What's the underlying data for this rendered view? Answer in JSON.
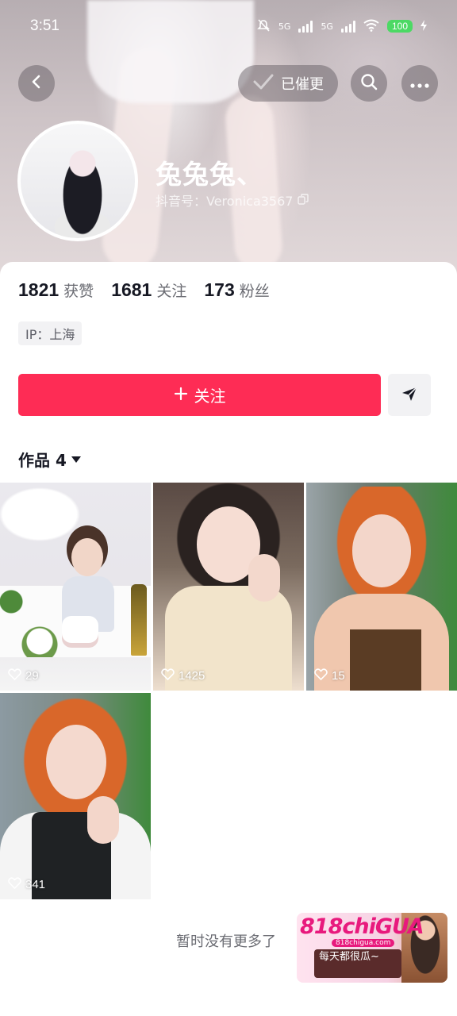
{
  "status_bar": {
    "time": "3:51",
    "network_1": "5G",
    "network_2": "5G",
    "battery": "100"
  },
  "top_bar": {
    "urge_label": "已催更"
  },
  "profile": {
    "name": "兔兔兔、",
    "uid_label": "抖音号：Veronica3567",
    "stats": [
      {
        "num": "1821",
        "label": "获赞"
      },
      {
        "num": "1681",
        "label": "关注"
      },
      {
        "num": "173",
        "label": "粉丝"
      }
    ],
    "ip": "IP：上海"
  },
  "actions": {
    "follow_label": "关注"
  },
  "works": {
    "tab_label": "作品 4",
    "items": [
      {
        "likes": "29"
      },
      {
        "likes": "1425"
      },
      {
        "likes": "15"
      },
      {
        "likes": "341"
      }
    ],
    "end_text": "暂时没有更多了"
  },
  "ad": {
    "brand": "818chiGUA",
    "url": "818chigua.com",
    "slogan": "每天都很瓜~"
  },
  "colors": {
    "accent": "#fe2c55",
    "text": "#161823",
    "muted": "#6b6c73"
  }
}
